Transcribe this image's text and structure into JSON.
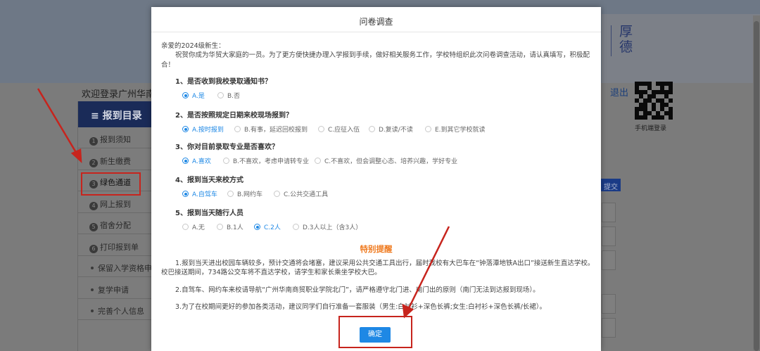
{
  "background": {
    "motto": "厚德",
    "welcome": "欢迎登录广州华南",
    "logout": "退出",
    "qr_label": "手机端登录",
    "submit_label": "提交",
    "sidebar": {
      "header": "≡ 报到目录",
      "items": [
        {
          "num": "1",
          "label": "报到须知"
        },
        {
          "num": "2",
          "label": "新生缴费"
        },
        {
          "num": "3",
          "label": "绿色通道"
        },
        {
          "num": "4",
          "label": "网上报到"
        },
        {
          "num": "5",
          "label": "宿舍分配"
        },
        {
          "num": "6",
          "label": "打印报到单"
        },
        {
          "num": "",
          "label": "保留入学资格申"
        },
        {
          "num": "",
          "label": "复学申请"
        },
        {
          "num": "",
          "label": "完善个人信息"
        }
      ]
    }
  },
  "modal": {
    "title": "问卷调查",
    "greeting": "亲爱的2024级新生：",
    "intro": "祝贺你成为华贸大家庭的一员。为了更方便快捷办理入学报到手续，做好相关服务工作，学校特组织此次问卷调查活动，请认真填写，积极配合！",
    "questions": [
      {
        "title": "1、是否收到我校录取通知书？",
        "options": [
          "A.是",
          "B.否"
        ],
        "selected": 0
      },
      {
        "title": "2、是否按照规定日期来校现场报到？",
        "options": [
          "A.按时报到",
          "B.有事，延迟回校报到",
          "C.应征入伍",
          "D.复读/不读",
          "E.到其它学校就读"
        ],
        "selected": 0
      },
      {
        "title": "3、你对目前录取专业是否喜欢？",
        "options": [
          "A.喜欢",
          "B.不喜欢，考虑申请转专业",
          "C.不喜欢，但会调整心态、培养兴趣，学好专业"
        ],
        "selected": 0
      },
      {
        "title": "4、报到当天来校方式",
        "options": [
          "A.自驾车",
          "B.网约车",
          "C.公共交通工具"
        ],
        "selected": 0
      },
      {
        "title": "5、报到当天随行人员",
        "options": [
          "A.无",
          "B.1人",
          "C.2人",
          "D.3人以上（含3人）"
        ],
        "selected": 2
      }
    ],
    "notice_title": "特别提醒",
    "notices": [
      "1.报到当天进出校园车辆较多，预计交通将会堵塞，建议采用公共交通工具出行，届时我校有大巴车在“钟落潭地铁A出口”接送新生直达学校。校巴接送期间，734路公交车将不直达学校，请学生和家长乘坐学校大巴。",
      "2.自驾车、网约车来校请导航“广州华南商贸职业学院北门”，请严格遵守北门进、南门出的原则（南门无法到达报到现场）。",
      "3.为了在校期间更好的参加各类活动，建议同学们自行准备一套服装（男生:白衬衫+深色长裤;女生:白衬衫+深色长裤/长裙）。"
    ],
    "confirm_label": "确定"
  },
  "colors": {
    "accent": "#1e88e5",
    "notice_title": "#ef7a1f",
    "annotation_red": "#c7241d",
    "sidebar_header": "#1a2b58"
  }
}
